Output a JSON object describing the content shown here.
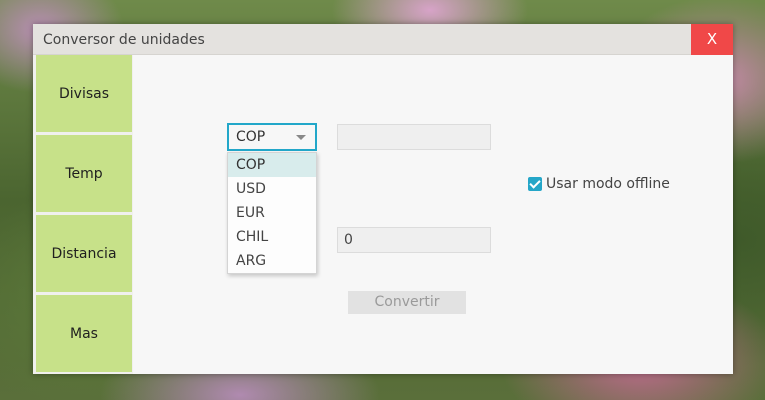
{
  "window": {
    "title": "Conversor de unidades",
    "close_label": "X"
  },
  "sidebar": {
    "items": [
      {
        "label": "Divisas"
      },
      {
        "label": "Temp"
      },
      {
        "label": "Distancia"
      },
      {
        "label": "Mas"
      }
    ]
  },
  "converter": {
    "currency_select": {
      "selected": "COP",
      "options": [
        "COP",
        "USD",
        "EUR",
        "CHIL",
        "ARG"
      ],
      "highlighted": "COP"
    },
    "input_value": "",
    "result_value": "0",
    "offline_checkbox": {
      "label": "Usar modo offline",
      "checked": true
    },
    "convert_label": "Convertir"
  },
  "colors": {
    "sidebar_button": "#c7e189",
    "accent": "#22a7c9",
    "close_button": "#f04848"
  }
}
